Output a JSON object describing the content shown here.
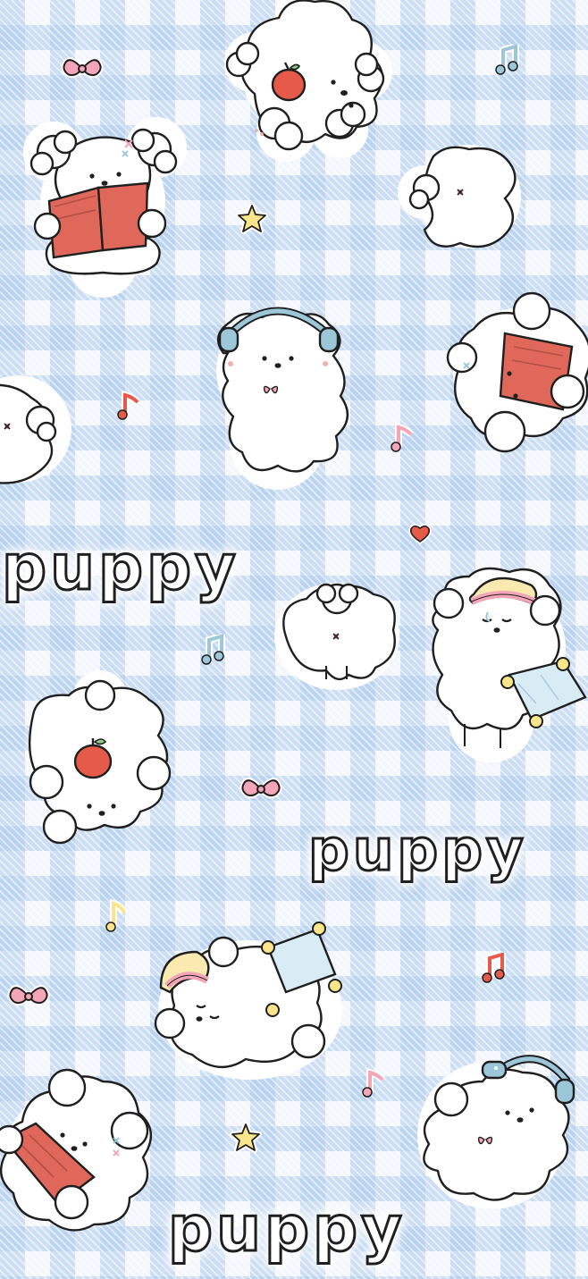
{
  "wallpaper": {
    "words": [
      "puppy",
      "puppy",
      "puppy"
    ],
    "colors": {
      "check_blue": "#accaec",
      "background": "#f3f7fd",
      "outline": "#1f1f1f",
      "fur": "#ffffff",
      "book_red": "#e0685b",
      "apple_red": "#e65a4a",
      "headphone_blue": "#9cc7d9",
      "nightcap_yellow": "#fbeab0",
      "star_yellow": "#fbe58a",
      "bow_pink": "#f4a6b8"
    },
    "stickers": [
      "puppy-apple-upside-down",
      "puppy-reading-book",
      "puppy-tail",
      "puppy-headphones",
      "puppy-reading-sideways",
      "puppy-tail",
      "puppy-sleeping-nightcap",
      "puppy-apple-upside-down",
      "puppy-sleeping-nightcap",
      "puppy-headphones",
      "puppy-reading-book"
    ],
    "decorations": [
      "pink-bow",
      "music-note",
      "star",
      "heart"
    ]
  }
}
